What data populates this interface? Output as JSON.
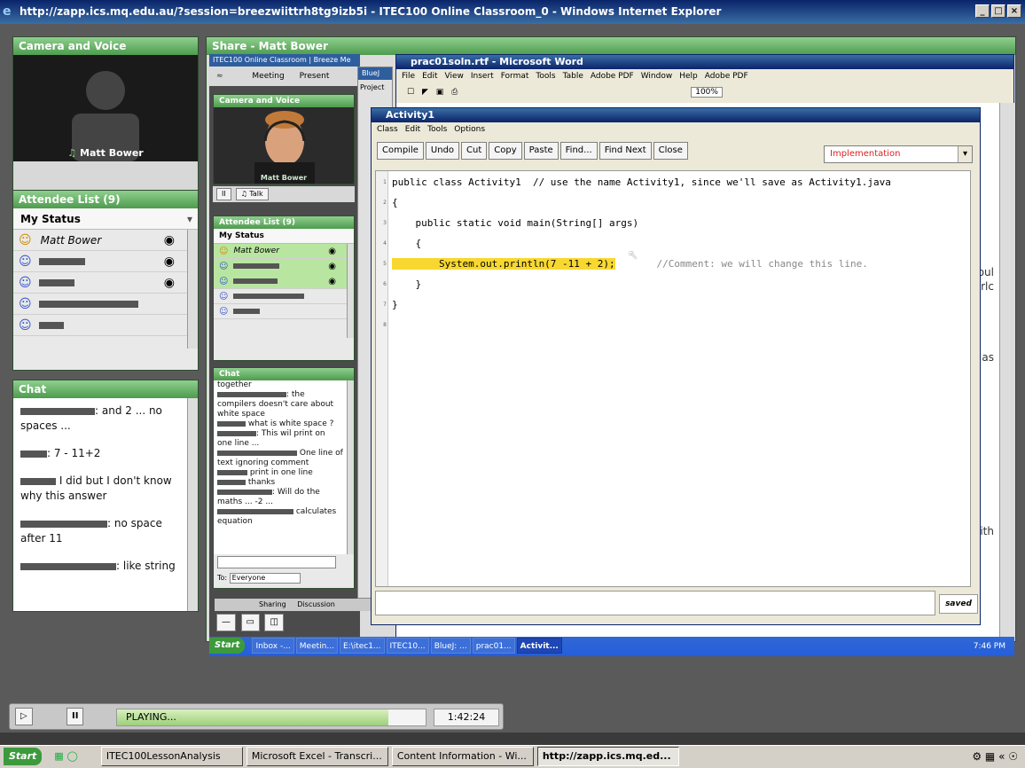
{
  "window": {
    "title": "http://zapp.ics.mq.edu.au/?session=breezwiittrh8tg9izb5i - ITEC100 Online Classroom_0 - Windows Internet Explorer",
    "min": "_",
    "max": "□",
    "close": "×"
  },
  "camera": {
    "title": "Camera and Voice",
    "name": "Matt Bower"
  },
  "attendees": {
    "title": "Attendee List (9)",
    "status_label": "My Status",
    "items": [
      {
        "name": "Matt Bower",
        "host": true
      },
      {
        "name": "",
        "mask": 52
      },
      {
        "name": "",
        "mask": 40
      },
      {
        "name": "",
        "mask": 112
      },
      {
        "name": "",
        "mask": 28
      }
    ]
  },
  "chat": {
    "title": "Chat",
    "messages": [
      {
        "mask": 84,
        "text": ": and 2 ... no spaces ..."
      },
      {
        "mask": 30,
        "text": ": 7 - 11+2"
      },
      {
        "mask": 40,
        "text": " I did but I don't know why this answer"
      },
      {
        "mask": 98,
        "text": ": no space after 11"
      },
      {
        "mask": 108,
        "text": ": like string"
      }
    ]
  },
  "share": {
    "title": "Share - Matt Bower",
    "inner_tab": "ITEC100 Online Classroom | Breeze Me",
    "meeting_menu": [
      "Meeting",
      "Present"
    ],
    "bluej_tab": "BlueJ",
    "project_label": "Project"
  },
  "inner": {
    "camera_title": "Camera and Voice",
    "camera_name": "Matt Bower",
    "talk_label": "Talk",
    "attendee_title": "Attendee List (9)",
    "status_label": "My Status",
    "attendees": [
      {
        "name": "Matt Bower",
        "host": true
      },
      {
        "name": "",
        "mask": 52
      },
      {
        "name": "",
        "mask": 50
      },
      {
        "name": "",
        "mask": 80
      },
      {
        "name": "",
        "mask": 30
      }
    ],
    "chat_title": "Chat",
    "chat_lines": [
      {
        "mask": 0,
        "text": "together"
      },
      {
        "mask": 78,
        "text": ": the"
      },
      {
        "mask": 0,
        "text": "compilers doesn't care about"
      },
      {
        "mask": 0,
        "text": "white space"
      },
      {
        "mask": 32,
        "text": " what is white space ?"
      },
      {
        "mask": 44,
        "text": ": This wil print on"
      },
      {
        "mask": 0,
        "text": "one line ..."
      },
      {
        "mask": 90,
        "text": " One line of"
      },
      {
        "mask": 0,
        "text": "text ignoring comment"
      },
      {
        "mask": 34,
        "text": " print in one line"
      },
      {
        "mask": 32,
        "text": " thanks"
      },
      {
        "mask": 62,
        "text": ": Will do the"
      },
      {
        "mask": 0,
        "text": "maths ... -2 ..."
      },
      {
        "mask": 86,
        "text": " calculates"
      },
      {
        "mask": 0,
        "text": "equation"
      }
    ],
    "to_label": "To:",
    "to_value": "Everyone",
    "tab_sharing": "Sharing",
    "tab_discussion": "Discussion",
    "taskbar": {
      "start": "Start",
      "buttons": [
        "Inbox -...",
        "Meetin...",
        "E:\\itec1...",
        "ITEC10...",
        "BlueJ: ...",
        "prac01...",
        "Activit..."
      ],
      "active": "Activit...",
      "time": "7:46 PM"
    }
  },
  "word": {
    "title": "prac01soln.rtf - Microsoft Word",
    "menu": [
      "File",
      "Edit",
      "View",
      "Insert",
      "Format",
      "Tools",
      "Table",
      "Adobe PDF",
      "Window",
      "Help",
      "Adobe PDF"
    ],
    "zoom": "100%",
    "side_words": [
      "oul",
      "orlc",
      "as",
      "ith"
    ]
  },
  "bluej": {
    "title": "Activity1",
    "menu": [
      "Class",
      "Edit",
      "Tools",
      "Options"
    ],
    "buttons": [
      "Compile",
      "Undo",
      "Cut",
      "Copy",
      "Paste",
      "Find...",
      "Find Next",
      "Close"
    ],
    "view": "Implementation",
    "code": [
      {
        "n": "1",
        "t": "public class Activity1  // use the name Activity1, since we'll save as Activity1.java"
      },
      {
        "n": "2",
        "t": "{"
      },
      {
        "n": "3",
        "t": "    public static void main(String[] args)"
      },
      {
        "n": "4",
        "t": "    {"
      },
      {
        "n": "5",
        "t": "        System.out.println(7 -11 + 2);",
        "c": "    //Comment: we will change this line."
      },
      {
        "n": "6",
        "t": "    }"
      },
      {
        "n": "7",
        "t": "}"
      },
      {
        "n": "8",
        "t": ""
      }
    ],
    "status": "saved"
  },
  "player": {
    "status": "PLAYING...",
    "time": "1:42:24",
    "progress": 0.88
  },
  "taskbar": {
    "start": "Start",
    "buttons": [
      "ITEC100LessonAnalysis",
      "Microsoft Excel - Transcri...",
      "Content Information - Wi...",
      "http://zapp.ics.mq.ed..."
    ],
    "active": "http://zapp.ics.mq.ed..."
  }
}
